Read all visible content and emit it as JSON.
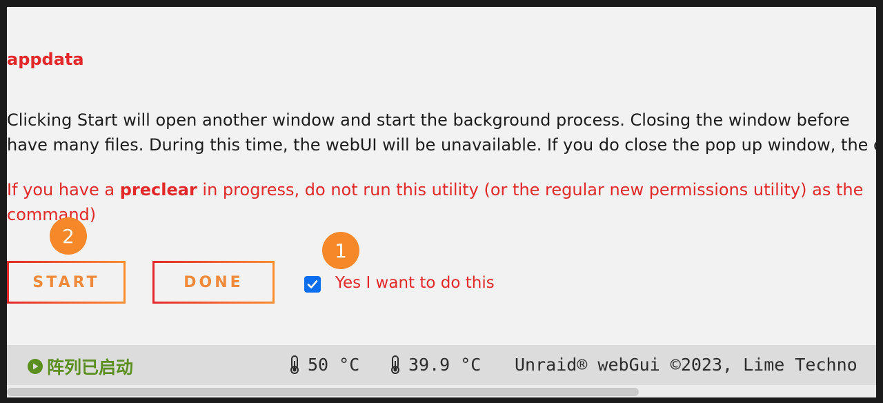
{
  "share": {
    "name": "appdata"
  },
  "info": {
    "line1": "Clicking Start will open another window and start the background process. Closing the window before",
    "line2": "have many files. During this time, the webUI will be unavailable. If you do close the pop up window, the c"
  },
  "warning": {
    "prefix": "If you have a ",
    "bold": "preclear",
    "suffix": " in progress, do not run this utility (or the regular new permissions utility) as the",
    "line2": "command)"
  },
  "buttons": {
    "start": "START",
    "done": "DONE"
  },
  "badges": {
    "one": "1",
    "two": "2"
  },
  "confirm": {
    "label": "Yes I want to do this",
    "checked": true
  },
  "footer": {
    "status": "阵列已启动",
    "temp1": "50 °C",
    "temp2": "39.9 °C",
    "credits": "Unraid® webGui ©2023, Lime Techno"
  },
  "colors": {
    "accent_red": "#e22828",
    "accent_orange": "#f7882a",
    "checkbox_blue": "#0b6df0",
    "status_green": "#5a8f1f"
  }
}
